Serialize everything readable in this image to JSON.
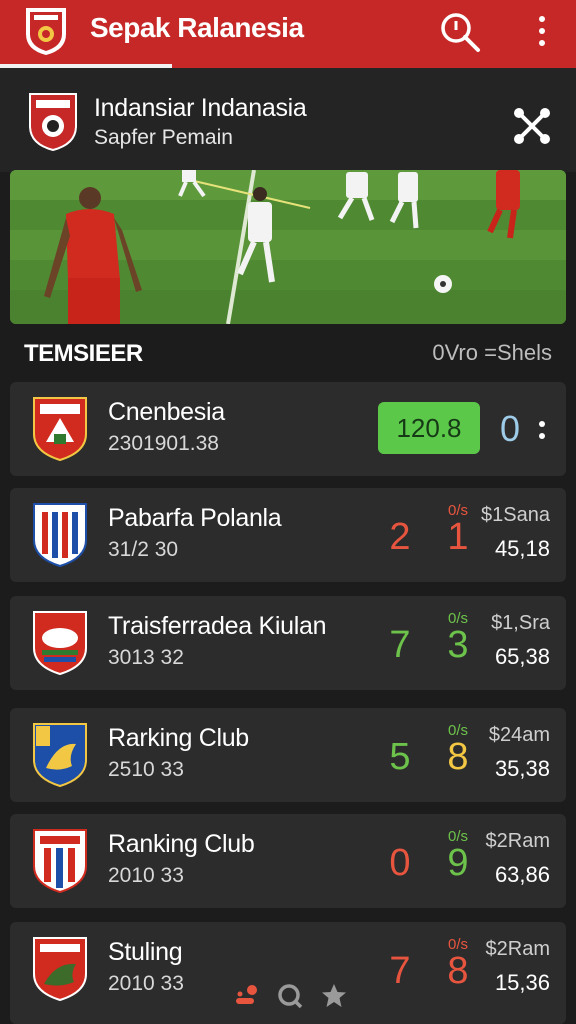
{
  "app": {
    "title": "Sepak Ralanesia"
  },
  "featured": {
    "name": "Indansiar Indanasia",
    "subtitle": "Sapfer Pemain"
  },
  "section": {
    "title": "TEMSIEER",
    "right_label": "0Vro =Shels"
  },
  "cards": [
    {
      "name": "Cnenbesia",
      "meta": "2301901.38",
      "pill": "120.8",
      "score": "0"
    },
    {
      "name": "Pabarfa Polanla",
      "meta": "31/2 30",
      "big1": "2",
      "small": "0/s",
      "big2": "1",
      "price": "$1Sana",
      "value": "45,18"
    },
    {
      "name": "Traisferradea Kiulan",
      "meta": "3013 32",
      "big1": "7",
      "small": "0/s",
      "big2": "3",
      "price": "$1,Sra",
      "value": "65,38"
    },
    {
      "name": "Rarking Club",
      "meta": "2510 33",
      "big1": "5",
      "small": "0/s",
      "big2": "8",
      "price": "$24am",
      "value": "35,38"
    },
    {
      "name": "Ranking Club",
      "meta": "2010 33",
      "big1": "0",
      "small": "0/s",
      "big2": "9",
      "price": "$2Ram",
      "value": "63,86"
    },
    {
      "name": "Stuling",
      "meta": "2010 33",
      "big1": "7",
      "small": "0/s",
      "big2": "8",
      "price": "$2Ram",
      "value": "15,36"
    }
  ],
  "icons": [
    "shield-logo-icon",
    "search-icon",
    "more-vertical-icon",
    "share-icon",
    "kebab-icon",
    "nav-home-icon",
    "nav-search-icon",
    "nav-star-icon"
  ],
  "colors": {
    "brand_red": "#c62828",
    "score_red": "#e8553f",
    "score_green": "#6cc24a",
    "score_yellow": "#f2c744",
    "pill_green": "#5cc84a"
  }
}
